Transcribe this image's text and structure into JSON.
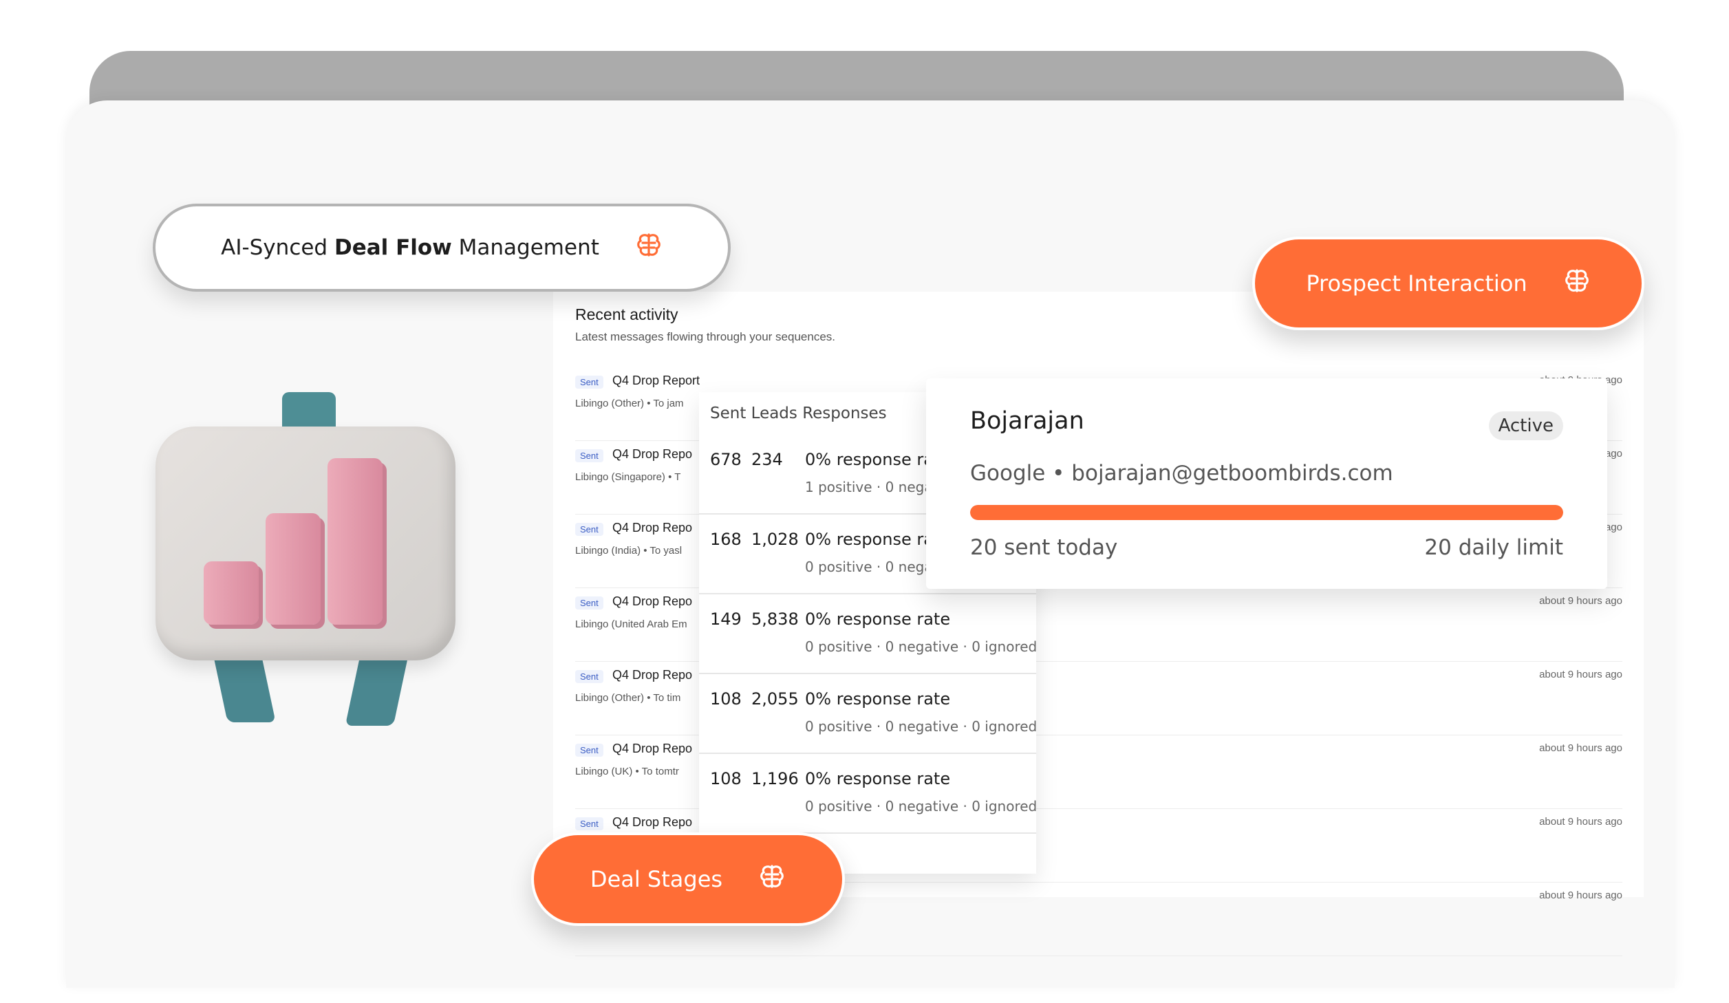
{
  "pills": {
    "deal_flow": {
      "prefix": "AI-Synced ",
      "bold": "Deal Flow",
      "suffix": " Management"
    },
    "prospect": "Prospect Interaction",
    "deal_stages": "Deal Stages",
    "icon": "brain-icon"
  },
  "colors": {
    "accent": "#ff6d36",
    "badge_text": "#3c5ec4"
  },
  "activity": {
    "title": "Recent activity",
    "subtitle": "Latest messages flowing through your sequences.",
    "rows": [
      {
        "badge": "Sent",
        "subject": "Q4 Drop Report",
        "meta": "Libingo (Other)   • To jam",
        "time": "about 9 hours ago"
      },
      {
        "badge": "Sent",
        "subject": "Q4 Drop Repo",
        "meta": "Libingo (Singapore)   • T",
        "time": "ago"
      },
      {
        "badge": "Sent",
        "subject": "Q4 Drop Repo",
        "meta": "Libingo (India)   • To yasl",
        "time": "ago"
      },
      {
        "badge": "Sent",
        "subject": "Q4 Drop Repo",
        "meta": "Libingo (United Arab Em",
        "time": "about 9 hours ago"
      },
      {
        "badge": "Sent",
        "subject": "Q4 Drop Repo",
        "meta": "Libingo (Other)   • To tim",
        "time": "about 9 hours ago"
      },
      {
        "badge": "Sent",
        "subject": "Q4 Drop Repo",
        "meta": "Libingo (UK)   • To tomtr",
        "time": "about 9 hours ago"
      },
      {
        "badge": "Sent",
        "subject": "Q4 Drop Repo",
        "meta": "",
        "time": "about 9 hours ago"
      },
      {
        "badge": "",
        "subject": "",
        "meta": "",
        "time": "about 9 hours ago"
      }
    ]
  },
  "leads": {
    "header": "Sent Leads  Responses",
    "rows": [
      {
        "sent": "678",
        "leads": "234",
        "rate": "0% response ra",
        "detail": "1 positive · 0 nega"
      },
      {
        "sent": "168",
        "leads": "1,028",
        "rate": "0% response ra",
        "detail": "0 positive · 0 nega"
      },
      {
        "sent": "149",
        "leads": "5,838",
        "rate": "0% response rate",
        "detail": "0 positive · 0 negative · 0 ignored"
      },
      {
        "sent": "108",
        "leads": "2,055",
        "rate": "0% response rate",
        "detail": "0 positive · 0 negative · 0 ignored"
      },
      {
        "sent": "108",
        "leads": "1,196",
        "rate": "0% response rate",
        "detail": "0 positive · 0 negative · 0 ignored"
      }
    ]
  },
  "prospect": {
    "name": "Bojarajan",
    "status": "Active",
    "company": "Google • bojarajan@getboombirds.com",
    "sent_today": "20 sent today",
    "daily_limit": "20 daily limit",
    "progress": 1.0
  }
}
